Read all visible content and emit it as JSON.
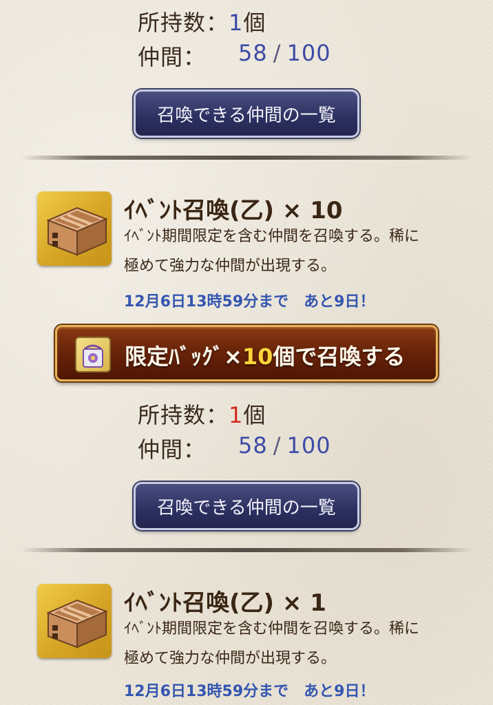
{
  "sections": [
    {
      "count_label": "所持数：",
      "count_value": "1",
      "count_unit": "個",
      "member_label": "仲間：",
      "member_current": "58",
      "member_sep": "/",
      "member_max": "100",
      "list_button": "召喚できる仲間の一覧"
    },
    {
      "title": "ｲﾍﾞﾝﾄ召喚(乙) × 10",
      "desc_line1": "ｲﾍﾞﾝﾄ期間限定を含む仲間を召喚する。稀に",
      "desc_line2": "極めて強力な仲間が出現する。",
      "deadline": "12月6日13時59分まで　あと9日！",
      "summon_prefix": "限定ﾊﾞｯｸﾞ×",
      "summon_num": "10",
      "summon_suffix": "個で召喚する",
      "count_label": "所持数：",
      "count_value": "1",
      "count_unit": "個",
      "member_label": "仲間：",
      "member_current": "58",
      "member_sep": "/",
      "member_max": "100",
      "list_button": "召喚できる仲間の一覧"
    },
    {
      "title": "ｲﾍﾞﾝﾄ召喚(乙) × 1",
      "desc_line1": "ｲﾍﾞﾝﾄ期間限定を含む仲間を召喚する。稀に",
      "desc_line2": "極めて強力な仲間が出現する。",
      "deadline": "12月6日13時59分まで　あと9日！"
    }
  ],
  "icons": {
    "crate": "wooden-crate-icon",
    "bag": "limited-bag-icon"
  },
  "colors": {
    "count_value_normal": "#3c4aa6",
    "count_value_low": "#d22b1c",
    "deadline": "#3456b0",
    "summon_button": "#6a240a",
    "list_button": "#2c3060"
  }
}
